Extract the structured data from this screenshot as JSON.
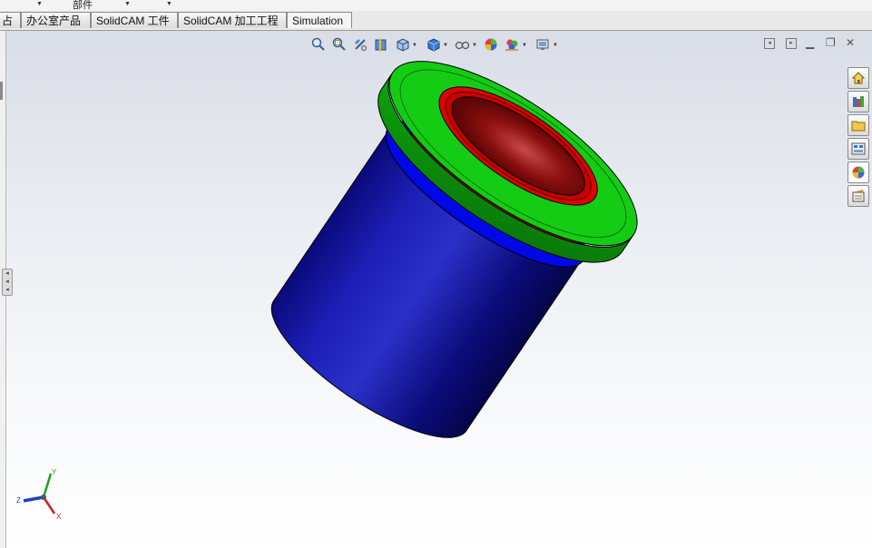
{
  "ribbon": {
    "group_label": "部件"
  },
  "tabs": [
    {
      "label": "占"
    },
    {
      "label": "办公室产品"
    },
    {
      "label": "SolidCAM 工件"
    },
    {
      "label": "SolidCAM 加工工程"
    },
    {
      "label": "Simulation"
    }
  ],
  "heads_up_toolbar": {
    "icons": [
      "zoom-to-fit-icon",
      "zoom-to-area-icon",
      "previous-view-icon",
      "section-view-icon",
      "view-orientation-icon",
      "display-style-icon",
      "hide-show-items-icon",
      "edit-appearance-icon",
      "apply-scene-icon",
      "view-settings-icon"
    ]
  },
  "task_pane": {
    "icons": [
      "solidworks-resources-icon",
      "design-library-icon",
      "file-explorer-icon",
      "view-palette-icon",
      "appearances-scenes-icon",
      "custom-properties-icon"
    ]
  },
  "triad": {
    "x_label": "X",
    "y_label": "Y",
    "z_label": "Z"
  },
  "model": {
    "name": "",
    "colors": {
      "body": "#0000c8",
      "flange": "#10c810",
      "bore": "#b40000"
    }
  }
}
